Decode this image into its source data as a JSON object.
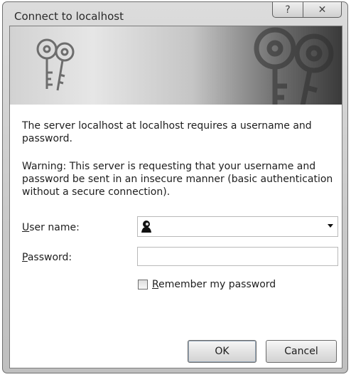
{
  "window": {
    "title": "Connect to localhost",
    "help_glyph": "?",
    "close_glyph": "✕"
  },
  "banner": {
    "icon": "keys-icon"
  },
  "message": {
    "line": "The server localhost at localhost requires a username and password.",
    "warning": "Warning: This server is requesting that your username and password be sent in an insecure manner (basic authentication without a secure connection)."
  },
  "form": {
    "username_label_u": "U",
    "username_label_rest": "ser name:",
    "username_value": "",
    "password_label_p": "P",
    "password_label_rest": "assword:",
    "password_value": "",
    "remember_label_r": "R",
    "remember_label_rest": "emember my password",
    "remember_checked": false
  },
  "buttons": {
    "ok": "OK",
    "cancel": "Cancel"
  }
}
